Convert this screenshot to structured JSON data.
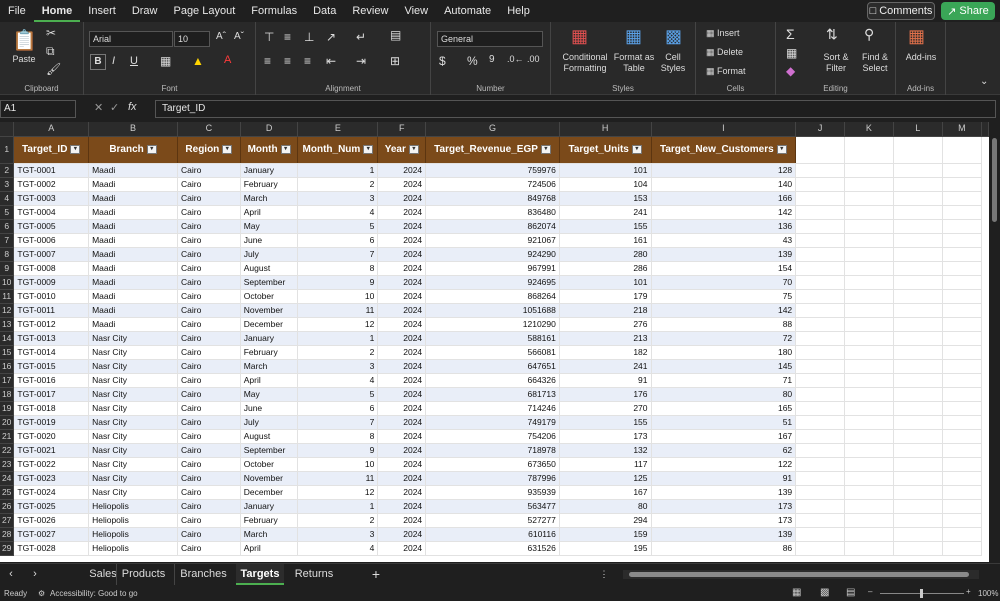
{
  "menu": [
    "File",
    "Home",
    "Insert",
    "Draw",
    "Page Layout",
    "Formulas",
    "Data",
    "Review",
    "View",
    "Automate",
    "Help"
  ],
  "topbar": {
    "comments_label": "Comments",
    "share_label": "Share"
  },
  "ribbon": {
    "clipboard": {
      "paste": "Paste",
      "label": "Clipboard"
    },
    "font": {
      "name": "Arial",
      "size": "10",
      "label": "Font"
    },
    "alignment": {
      "label": "Alignment"
    },
    "number": {
      "format": "General",
      "label": "Number"
    },
    "styles": {
      "conditional": "Conditional\nFormatting",
      "format_table": "Format as\nTable",
      "cell_styles": "Cell\nStyles",
      "label": "Styles"
    },
    "cells": {
      "insert": "Insert",
      "delete": "Delete",
      "format": "Format",
      "label": "Cells"
    },
    "editing": {
      "sort": "Sort &\nFilter",
      "find": "Find &\nSelect",
      "label": "Editing"
    },
    "addins": {
      "button": "Add-ins",
      "label": "Add-ins"
    }
  },
  "formula_bar": {
    "name_box": "A1",
    "fx": "fx",
    "content": "Target_ID"
  },
  "columns": [
    "A",
    "B",
    "C",
    "D",
    "E",
    "F",
    "G",
    "H",
    "I",
    "J",
    "K",
    "L",
    "M"
  ],
  "headers": [
    "Target_ID",
    "Branch",
    "Region",
    "Month",
    "Month_Num",
    "Year",
    "Target_Revenue_EGP",
    "Target_Units",
    "Target_New_Customers"
  ],
  "rows": [
    [
      "TGT-0001",
      "Maadi",
      "Cairo",
      "January",
      "1",
      "2024",
      "759976",
      "101",
      "128"
    ],
    [
      "TGT-0002",
      "Maadi",
      "Cairo",
      "February",
      "2",
      "2024",
      "724506",
      "104",
      "140"
    ],
    [
      "TGT-0003",
      "Maadi",
      "Cairo",
      "March",
      "3",
      "2024",
      "849768",
      "153",
      "166"
    ],
    [
      "TGT-0004",
      "Maadi",
      "Cairo",
      "April",
      "4",
      "2024",
      "836480",
      "241",
      "142"
    ],
    [
      "TGT-0005",
      "Maadi",
      "Cairo",
      "May",
      "5",
      "2024",
      "862074",
      "155",
      "136"
    ],
    [
      "TGT-0006",
      "Maadi",
      "Cairo",
      "June",
      "6",
      "2024",
      "921067",
      "161",
      "43"
    ],
    [
      "TGT-0007",
      "Maadi",
      "Cairo",
      "July",
      "7",
      "2024",
      "924290",
      "280",
      "139"
    ],
    [
      "TGT-0008",
      "Maadi",
      "Cairo",
      "August",
      "8",
      "2024",
      "967991",
      "286",
      "154"
    ],
    [
      "TGT-0009",
      "Maadi",
      "Cairo",
      "September",
      "9",
      "2024",
      "924695",
      "101",
      "70"
    ],
    [
      "TGT-0010",
      "Maadi",
      "Cairo",
      "October",
      "10",
      "2024",
      "868264",
      "179",
      "75"
    ],
    [
      "TGT-0011",
      "Maadi",
      "Cairo",
      "November",
      "11",
      "2024",
      "1051688",
      "218",
      "142"
    ],
    [
      "TGT-0012",
      "Maadi",
      "Cairo",
      "December",
      "12",
      "2024",
      "1210290",
      "276",
      "88"
    ],
    [
      "TGT-0013",
      "Nasr City",
      "Cairo",
      "January",
      "1",
      "2024",
      "588161",
      "213",
      "72"
    ],
    [
      "TGT-0014",
      "Nasr City",
      "Cairo",
      "February",
      "2",
      "2024",
      "566081",
      "182",
      "180"
    ],
    [
      "TGT-0015",
      "Nasr City",
      "Cairo",
      "March",
      "3",
      "2024",
      "647651",
      "241",
      "145"
    ],
    [
      "TGT-0016",
      "Nasr City",
      "Cairo",
      "April",
      "4",
      "2024",
      "664326",
      "91",
      "71"
    ],
    [
      "TGT-0017",
      "Nasr City",
      "Cairo",
      "May",
      "5",
      "2024",
      "681713",
      "176",
      "80"
    ],
    [
      "TGT-0018",
      "Nasr City",
      "Cairo",
      "June",
      "6",
      "2024",
      "714246",
      "270",
      "165"
    ],
    [
      "TGT-0019",
      "Nasr City",
      "Cairo",
      "July",
      "7",
      "2024",
      "749179",
      "155",
      "51"
    ],
    [
      "TGT-0020",
      "Nasr City",
      "Cairo",
      "August",
      "8",
      "2024",
      "754206",
      "173",
      "167"
    ],
    [
      "TGT-0021",
      "Nasr City",
      "Cairo",
      "September",
      "9",
      "2024",
      "718978",
      "132",
      "62"
    ],
    [
      "TGT-0022",
      "Nasr City",
      "Cairo",
      "October",
      "10",
      "2024",
      "673650",
      "117",
      "122"
    ],
    [
      "TGT-0023",
      "Nasr City",
      "Cairo",
      "November",
      "11",
      "2024",
      "787996",
      "125",
      "91"
    ],
    [
      "TGT-0024",
      "Nasr City",
      "Cairo",
      "December",
      "12",
      "2024",
      "935939",
      "167",
      "139"
    ],
    [
      "TGT-0025",
      "Heliopolis",
      "Cairo",
      "January",
      "1",
      "2024",
      "563477",
      "80",
      "173"
    ],
    [
      "TGT-0026",
      "Heliopolis",
      "Cairo",
      "February",
      "2",
      "2024",
      "527277",
      "294",
      "173"
    ],
    [
      "TGT-0027",
      "Heliopolis",
      "Cairo",
      "March",
      "3",
      "2024",
      "610116",
      "159",
      "139"
    ],
    [
      "TGT-0028",
      "Heliopolis",
      "Cairo",
      "April",
      "4",
      "2024",
      "631526",
      "195",
      "86"
    ]
  ],
  "sheet_tabs": [
    "Sales",
    "Products",
    "Branches",
    "Targets",
    "Returns"
  ],
  "active_tab": "Targets",
  "status": {
    "ready": "Ready",
    "accessibility": "Accessibility: Good to go",
    "zoom": "100%"
  }
}
